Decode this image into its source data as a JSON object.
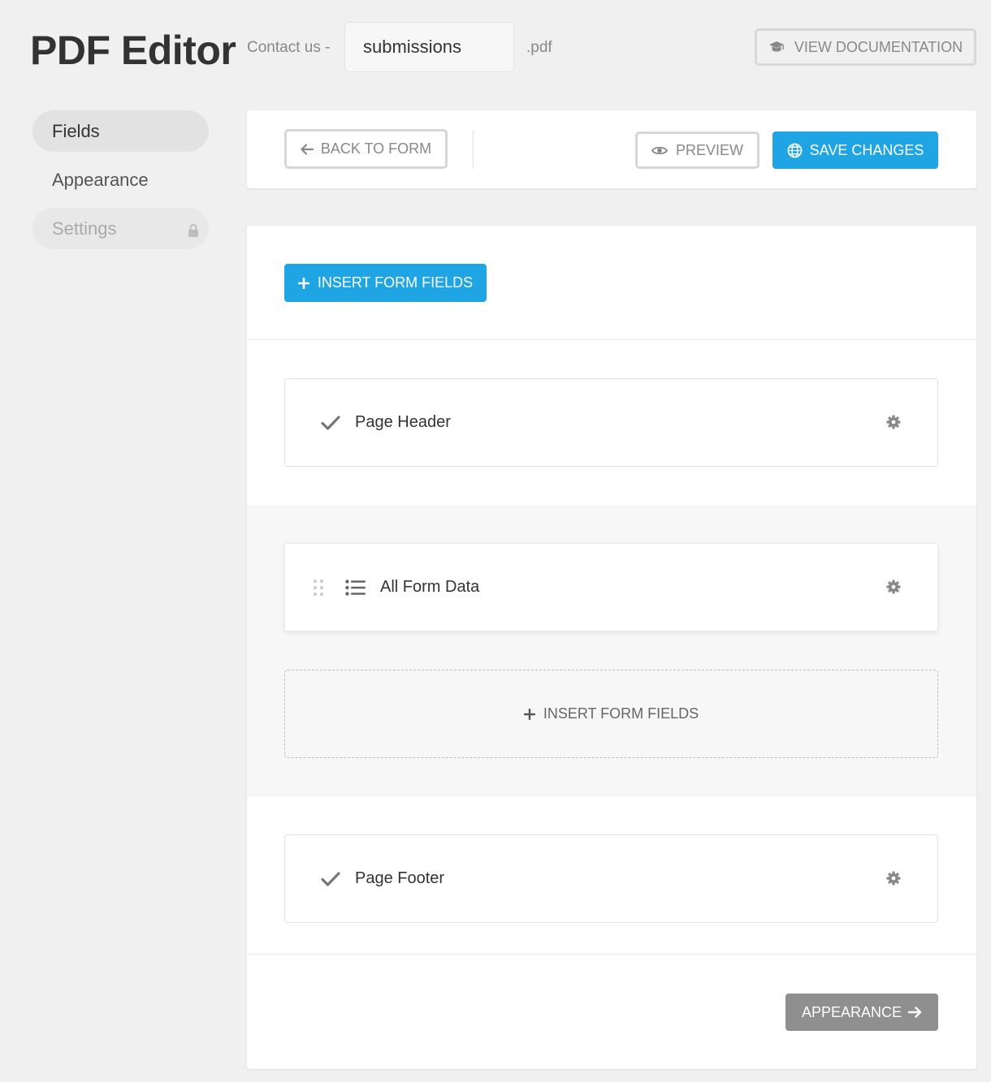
{
  "header": {
    "title": "PDF Editor",
    "filename_prefix": "Contact us -",
    "filename_value": "submissions",
    "filename_ext": ".pdf",
    "docs_button": "VIEW DOCUMENTATION"
  },
  "sidebar": {
    "items": [
      {
        "label": "Fields",
        "state": "active"
      },
      {
        "label": "Appearance",
        "state": "normal"
      },
      {
        "label": "Settings",
        "state": "locked"
      }
    ]
  },
  "toolbar": {
    "back_label": "BACK TO FORM",
    "preview_label": "PREVIEW",
    "save_label": "SAVE CHANGES"
  },
  "builder": {
    "insert_top_label": "INSERT FORM FIELDS",
    "rows": [
      {
        "label": "Page Header",
        "icon": "check-icon"
      },
      {
        "label": "All Form Data",
        "icon": "list-icon"
      },
      {
        "label": "Page Footer",
        "icon": "check-icon"
      }
    ],
    "dropzone_label": "INSERT FORM FIELDS",
    "next_label": "APPEARANCE"
  },
  "colors": {
    "primary": "#1fa5e3",
    "secondary_button": "#8f8f8f",
    "background": "#f0f0f0"
  }
}
